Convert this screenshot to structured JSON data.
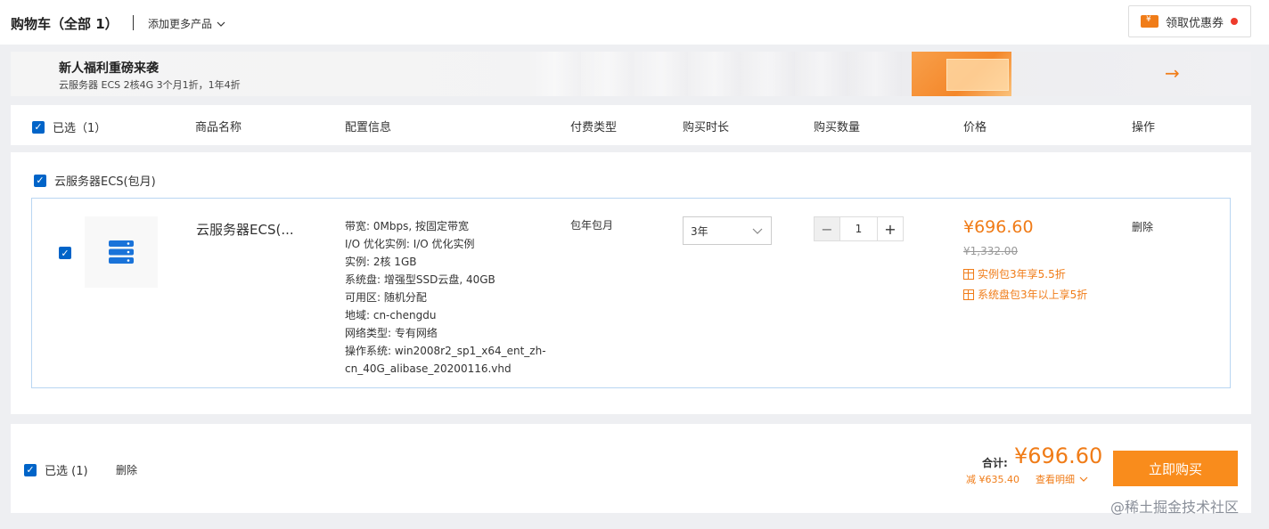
{
  "topbar": {
    "title": "购物车（全部 1）",
    "add_more": "添加更多产品",
    "coupon_label": "领取优惠券"
  },
  "banner": {
    "title": "新人福利重磅来袭",
    "subtitle": "云服务器 ECS 2核4G 3个月1折，1年4折"
  },
  "table_header": {
    "selected": "已选（1）",
    "columns": [
      "商品名称",
      "配置信息",
      "付费类型",
      "购买时长",
      "购买数量",
      "价格",
      "操作"
    ]
  },
  "group": {
    "title": "云服务器ECS(包月)",
    "item": {
      "name": "云服务器ECS(...",
      "config": [
        "带宽: 0Mbps, 按固定带宽",
        "I/O 优化实例: I/O 优化实例",
        "实例: 2核 1GB",
        "系统盘: 增强型SSD云盘, 40GB",
        "可用区: 随机分配",
        "地域: cn-chengdu",
        "网络类型: 专有网络",
        "操作系统: win2008r2_sp1_x64_ent_zh-cn_40G_alibase_20200116.vhd"
      ],
      "billing": "包年包月",
      "duration": "3年",
      "quantity": "1",
      "price": "¥696.60",
      "original_price": "¥1,332.00",
      "promos": [
        "实例包3年享5.5折",
        "系统盘包3年以上享5折"
      ],
      "delete": "删除"
    }
  },
  "footer": {
    "selected": "已选 (1)",
    "delete": "删除",
    "total_label": "合计:",
    "total_value": "¥696.60",
    "saved": "减 ¥635.40",
    "detail": "查看明细",
    "buy": "立即购买"
  },
  "watermark": "@稀土掘金技术社区",
  "colors": {
    "accent": "#f07c18",
    "primary": "#0064c8",
    "buy_button": "#f98c1c"
  }
}
